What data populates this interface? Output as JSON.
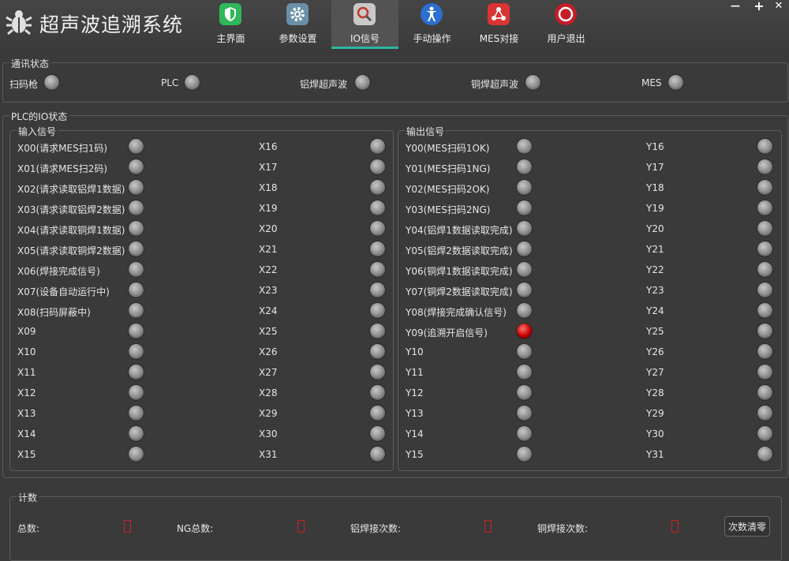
{
  "app": {
    "title": "超声波追溯系统"
  },
  "nav": [
    {
      "label": "主界面",
      "icon": "shield-icon",
      "color": "#2fb85a"
    },
    {
      "label": "参数设置",
      "icon": "gear-icon",
      "color": "#6a8fa8"
    },
    {
      "label": "IO信号",
      "icon": "search-icon",
      "color": "#c9c9c9"
    },
    {
      "label": "手动操作",
      "icon": "accessibility-icon",
      "color": "#2d6fd0"
    },
    {
      "label": "MES对接",
      "icon": "network-icon",
      "color": "#d83434"
    },
    {
      "label": "用户退出",
      "icon": "power-icon",
      "color": "#c41e2a"
    }
  ],
  "active_tab": "IO信号",
  "window": {
    "minimize": "—",
    "maximize": "+",
    "close": "✕"
  },
  "comm": {
    "title": "通讯状态",
    "items": [
      {
        "label": "扫码枪",
        "on": false
      },
      {
        "label": "PLC",
        "on": false
      },
      {
        "label": "铝焊超声波",
        "on": false
      },
      {
        "label": "铜焊超声波",
        "on": false
      },
      {
        "label": "MES",
        "on": false
      }
    ]
  },
  "io": {
    "title": "PLC的IO状态",
    "inputs": {
      "title": "输入信号",
      "col1": [
        "X00(请求MES扫1码)",
        "X01(请求MES扫2码)",
        "X02(请求读取铝焊1数据)",
        "X03(请求读取铝焊2数据)",
        "X04(请求读取铜焊1数据)",
        "X05(请求读取铜焊2数据)",
        "X06(焊接完成信号)",
        "X07(设备自动运行中)",
        "X08(扫码屏蔽中)",
        "X09",
        "X10",
        "X11",
        "X12",
        "X13",
        "X14",
        "X15"
      ],
      "col2": [
        "X16",
        "X17",
        "X18",
        "X19",
        "X20",
        "X21",
        "X22",
        "X23",
        "X24",
        "X25",
        "X26",
        "X27",
        "X28",
        "X29",
        "X30",
        "X31"
      ]
    },
    "outputs": {
      "title": "输出信号",
      "col1": [
        "Y00(MES扫码1OK)",
        "Y01(MES扫码1NG)",
        "Y02(MES扫码2OK)",
        "Y03(MES扫码2NG)",
        "Y04(铝焊1数据读取完成)",
        "Y05(铝焊2数据读取完成)",
        "Y06(铜焊1数据读取完成)",
        "Y07(铜焊2数据读取完成)",
        "Y08(焊接完成确认信号)",
        "Y09(追溯开启信号)",
        "Y10",
        "Y11",
        "Y12",
        "Y13",
        "Y14",
        "Y15"
      ],
      "col2": [
        "Y16",
        "Y17",
        "Y18",
        "Y19",
        "Y20",
        "Y21",
        "Y22",
        "Y23",
        "Y24",
        "Y25",
        "Y26",
        "Y27",
        "Y28",
        "Y29",
        "Y30",
        "Y31"
      ],
      "on_signals": [
        "Y09(追溯开启信号)"
      ]
    }
  },
  "counter": {
    "title": "计数",
    "items": [
      {
        "label": "总数:",
        "value": ""
      },
      {
        "label": "NG总数:",
        "value": ""
      },
      {
        "label": "铝焊接次数:",
        "value": ""
      },
      {
        "label": "铜焊接次数:",
        "value": ""
      }
    ],
    "value_color": "#d12020",
    "reset_label": "次数清零"
  }
}
